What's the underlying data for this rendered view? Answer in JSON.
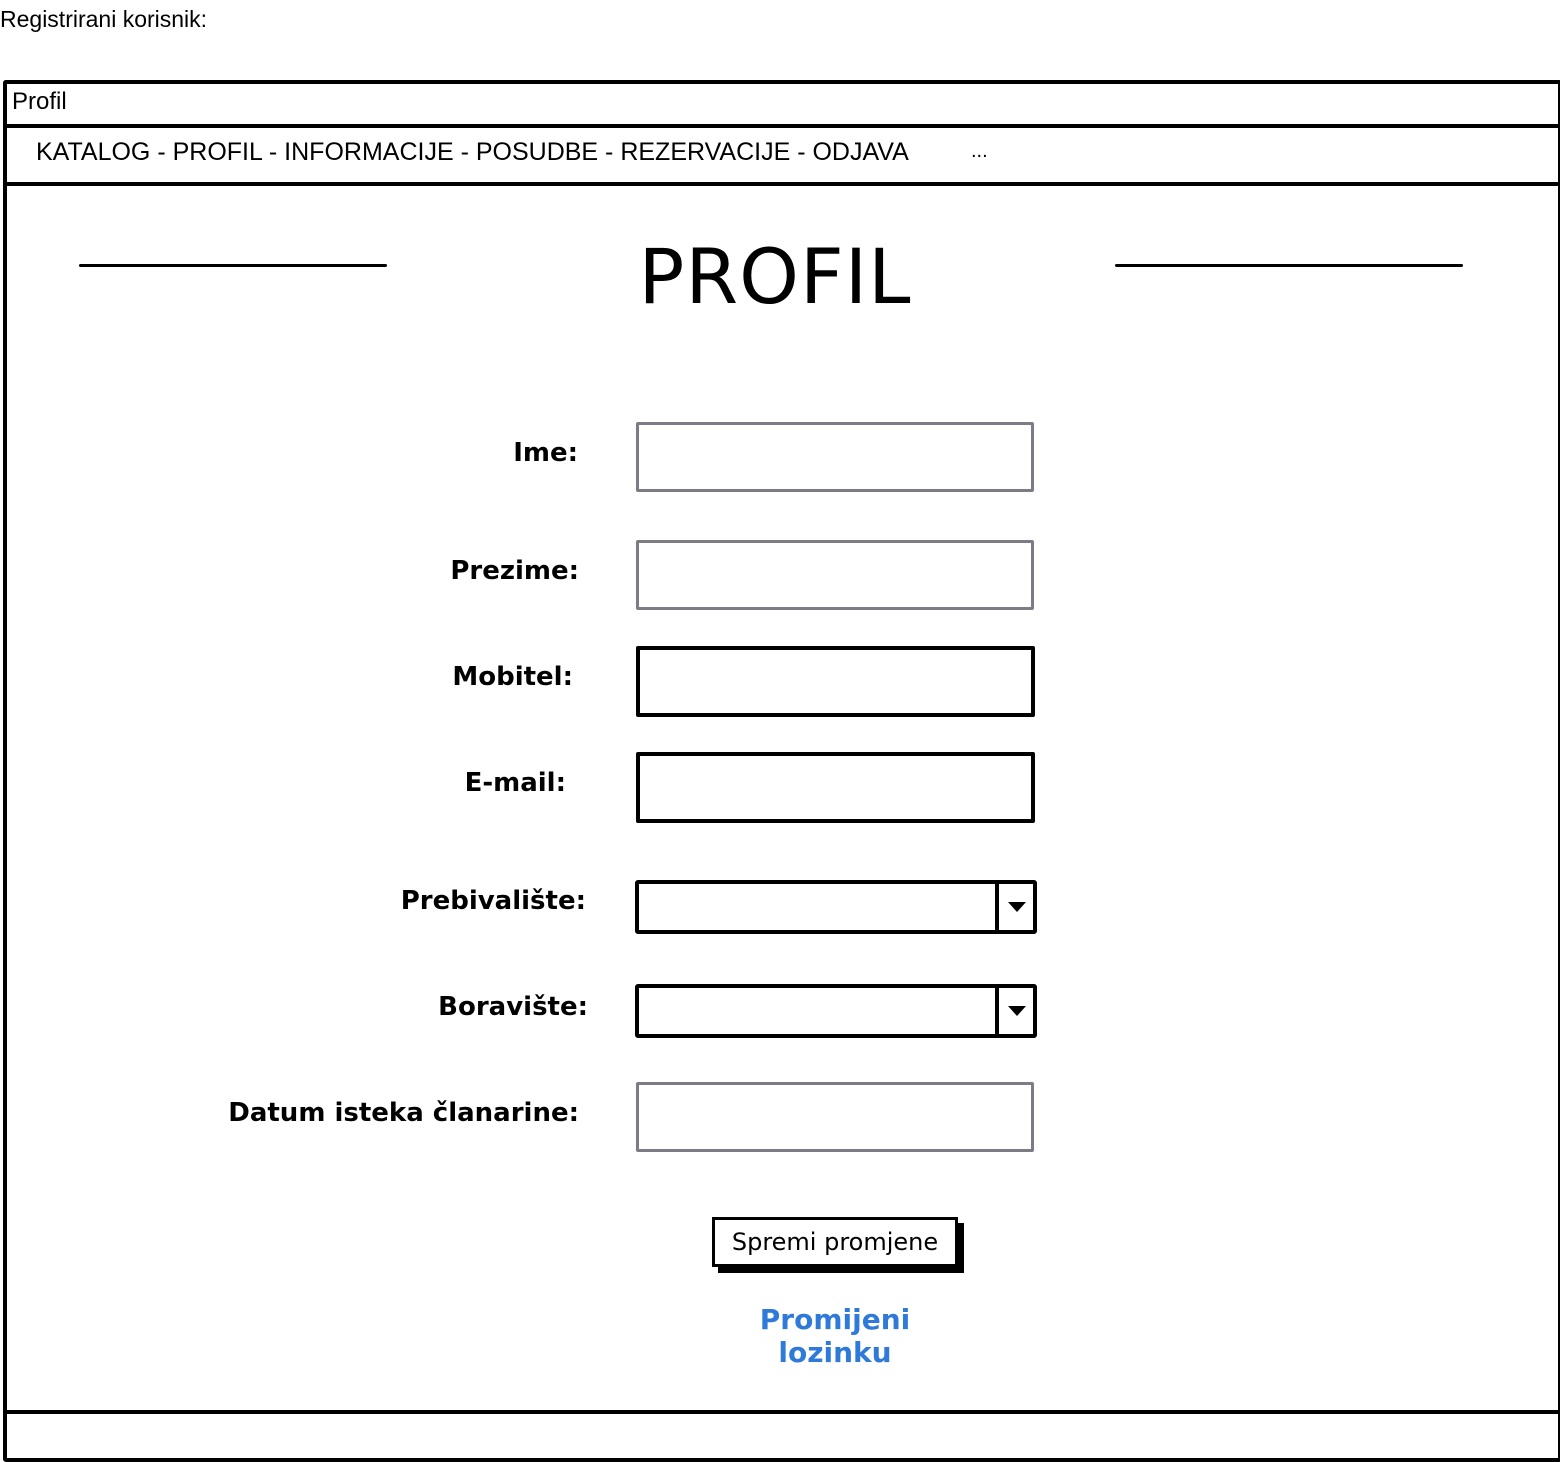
{
  "caption": "Registrirani korisnik:",
  "window": {
    "title": "Profil"
  },
  "nav": {
    "links_text": "KATALOG - PROFIL - INFORMACIJE - POSUDBE - REZERVACIJE - ODJAVA",
    "more": "..."
  },
  "page": {
    "title": "PROFIL"
  },
  "form": {
    "ime_label": "Ime:",
    "ime_value": "",
    "prezime_label": "Prezime:",
    "prezime_value": "",
    "mobitel_label": "Mobitel:",
    "mobitel_value": "",
    "email_label": "E-mail:",
    "email_value": "",
    "prebivaliste_label": "Prebivalište:",
    "prebivaliste_value": "",
    "boraviste_label": "Boravište:",
    "boraviste_value": "",
    "datum_label": "Datum isteka članarine:",
    "datum_value": ""
  },
  "actions": {
    "save_label": "Spremi promjene",
    "change_password_label": "Promijeni lozinku"
  },
  "colors": {
    "link": "#2f7ad8",
    "readonly_border": "#7c7c86"
  }
}
